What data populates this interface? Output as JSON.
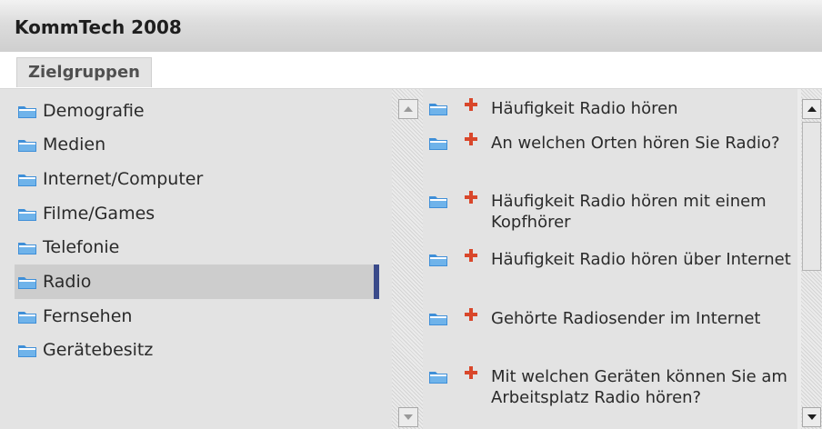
{
  "header": {
    "title": "KommTech 2008"
  },
  "tabs": [
    {
      "label": "Zielgruppen"
    }
  ],
  "categories": [
    {
      "label": "Demografie"
    },
    {
      "label": "Medien"
    },
    {
      "label": "Internet/Computer"
    },
    {
      "label": "Filme/Games"
    },
    {
      "label": "Telefonie"
    },
    {
      "label": "Radio",
      "selected": true
    },
    {
      "label": "Fernsehen"
    },
    {
      "label": "Gerätebesitz"
    }
  ],
  "questions": [
    {
      "label": "Häufigkeit Radio hören"
    },
    {
      "label": "An welchen Orten hören Sie Radio?"
    },
    {
      "label": "Häufigkeit Radio hören mit einem Kopfhörer"
    },
    {
      "label": "Häufigkeit Radio hören über Internet"
    },
    {
      "label": "Gehörte Radiosender im Internet"
    },
    {
      "label": "Mit welchen Geräten können Sie am Arbeitsplatz Radio hören?"
    }
  ],
  "icons": {
    "folder": "folder-icon",
    "add": "plus-icon",
    "scroll_up": "arrow-up-icon",
    "scroll_down": "arrow-down-icon"
  },
  "colors": {
    "folder": "#3f8fd8",
    "plus": "#d9472b",
    "selection_marker": "#3a4a8a"
  }
}
